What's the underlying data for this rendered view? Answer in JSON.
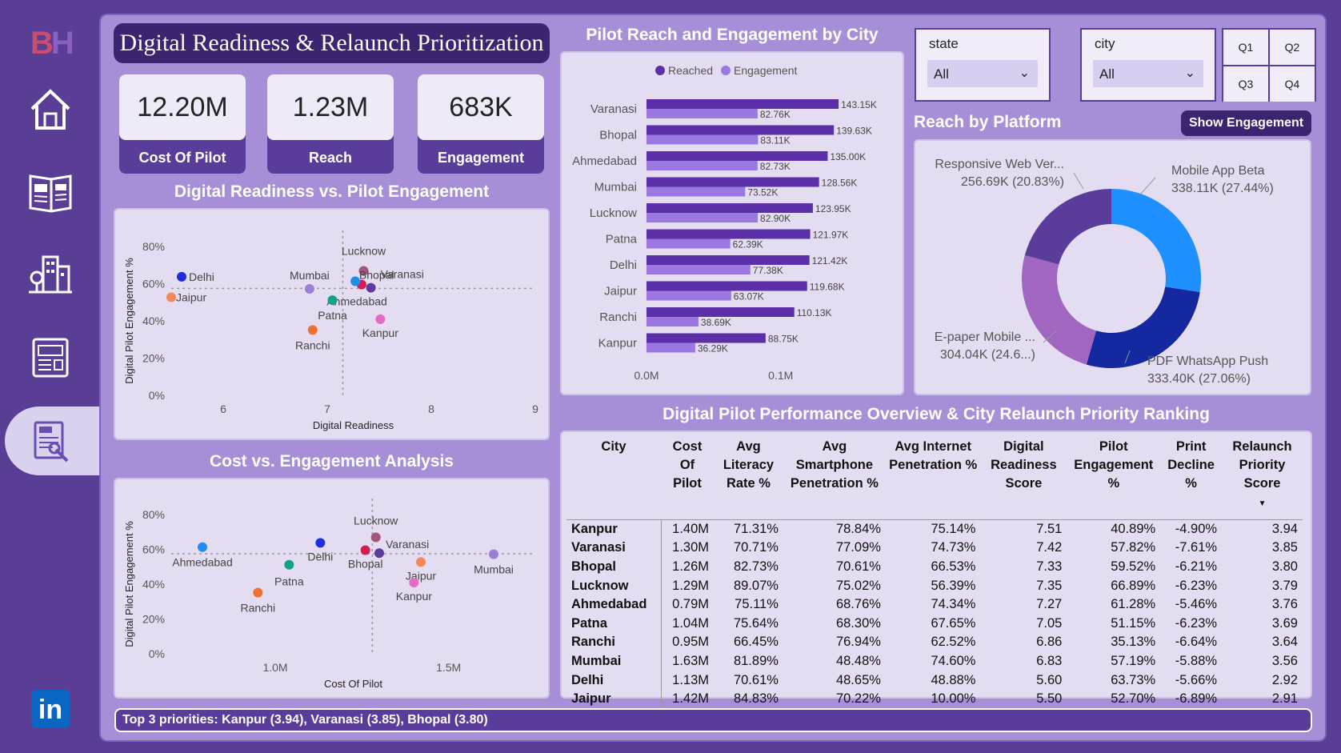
{
  "sidebar": {
    "logo_b": "B",
    "logo_h": "H",
    "items": [
      {
        "name": "home-icon"
      },
      {
        "name": "newspaper-icon"
      },
      {
        "name": "city-buildings-icon"
      },
      {
        "name": "news-report-icon"
      },
      {
        "name": "news-reader-icon",
        "active": true
      }
    ],
    "linkedin_label": "in"
  },
  "header": {
    "title": "Digital Readiness & Relaunch Prioritization"
  },
  "kpis": [
    {
      "value": "12.20M",
      "label": "Cost Of Pilot"
    },
    {
      "value": "1.23M",
      "label": "Reach"
    },
    {
      "value": "683K",
      "label": "Engagement"
    }
  ],
  "filters": {
    "state_label": "state",
    "state_value": "All",
    "city_label": "city",
    "city_value": "All",
    "quarters": [
      "Q1",
      "Q2",
      "Q3",
      "Q4"
    ]
  },
  "show_engagement_label": "Show Engagement",
  "colors": {
    "reached": "#5a2fa8",
    "engagement": "#9b77e0",
    "accent": "#3c2471"
  },
  "chart_data": [
    {
      "id": "readiness_scatter",
      "type": "scatter",
      "title": "Digital Readiness vs. Pilot Engagement",
      "xlabel": "Digital Readiness",
      "ylabel": "Digital Pilot Engagement %",
      "xlim": [
        5.5,
        9
      ],
      "ylim": [
        0,
        80
      ],
      "xticks": [
        "6",
        "7",
        "8",
        "9"
      ],
      "yticks": [
        "0%",
        "20%",
        "40%",
        "60%",
        "80%"
      ],
      "ref_x": 7.15,
      "ref_y": 57.5,
      "points": [
        {
          "label": "Delhi",
          "x": 5.6,
          "y": 63.73,
          "color": "#1f2de0"
        },
        {
          "label": "Jaipur",
          "x": 5.5,
          "y": 52.7,
          "color": "#f08a5a"
        },
        {
          "label": "Mumbai",
          "x": 6.83,
          "y": 57.19,
          "color": "#9b7ed8"
        },
        {
          "label": "Lucknow",
          "x": 7.35,
          "y": 66.89,
          "color": "#a0587a"
        },
        {
          "label": "Bhopal",
          "x": 7.33,
          "y": 59.52,
          "color": "#d11c54"
        },
        {
          "label": "Varanasi",
          "x": 7.42,
          "y": 57.82,
          "color": "#5a3c9a"
        },
        {
          "label": "Ahmedabad",
          "x": 7.27,
          "y": 61.28,
          "color": "#1f8cf0"
        },
        {
          "label": "Patna",
          "x": 7.05,
          "y": 51.15,
          "color": "#17a089"
        },
        {
          "label": "Kanpur",
          "x": 7.51,
          "y": 40.89,
          "color": "#e36bc1"
        },
        {
          "label": "Ranchi",
          "x": 6.86,
          "y": 35.13,
          "color": "#f2702d"
        }
      ]
    },
    {
      "id": "cost_scatter",
      "type": "scatter",
      "title": "Cost vs. Engagement Analysis",
      "xlabel": "Cost Of Pilot",
      "ylabel": "Digital Pilot Engagement %",
      "xlim": [
        0.7,
        1.75
      ],
      "ylim": [
        0,
        80
      ],
      "xticks": [
        "1.0M",
        "1.5M"
      ],
      "yticks": [
        "0%",
        "20%",
        "40%",
        "60%",
        "80%"
      ],
      "ref_x": 1.28,
      "ref_y": 57.5,
      "points": [
        {
          "label": "Ahmedabad",
          "x": 0.79,
          "y": 61.28,
          "color": "#1f8cf0"
        },
        {
          "label": "Delhi",
          "x": 1.13,
          "y": 63.73,
          "color": "#1f2de0"
        },
        {
          "label": "Patna",
          "x": 1.04,
          "y": 51.15,
          "color": "#17a089"
        },
        {
          "label": "Ranchi",
          "x": 0.95,
          "y": 35.13,
          "color": "#f2702d"
        },
        {
          "label": "Lucknow",
          "x": 1.29,
          "y": 66.89,
          "color": "#a0587a"
        },
        {
          "label": "Bhopal",
          "x": 1.26,
          "y": 59.52,
          "color": "#d11c54"
        },
        {
          "label": "Varanasi",
          "x": 1.3,
          "y": 57.82,
          "color": "#5a3c9a"
        },
        {
          "label": "Jaipur",
          "x": 1.42,
          "y": 52.7,
          "color": "#f08a5a"
        },
        {
          "label": "Kanpur",
          "x": 1.4,
          "y": 40.89,
          "color": "#e36bc1"
        },
        {
          "label": "Mumbai",
          "x": 1.63,
          "y": 57.19,
          "color": "#9b7ed8"
        }
      ]
    },
    {
      "id": "reach_bar",
      "type": "bar",
      "orientation": "horizontal",
      "title": "Pilot Reach and Engagement by City",
      "legend": [
        "Reached",
        "Engagement"
      ],
      "xticks": [
        "0.0M",
        "0.1M"
      ],
      "xlim": [
        0,
        0.155
      ],
      "categories": [
        "Varanasi",
        "Bhopal",
        "Ahmedabad",
        "Mumbai",
        "Lucknow",
        "Patna",
        "Delhi",
        "Jaipur",
        "Ranchi",
        "Kanpur"
      ],
      "series": [
        {
          "name": "Reached",
          "values": [
            143.15,
            139.63,
            135.0,
            128.56,
            123.95,
            121.97,
            121.42,
            119.68,
            110.13,
            88.75
          ],
          "labels": [
            "143.15K",
            "139.63K",
            "135.00K",
            "128.56K",
            "123.95K",
            "121.97K",
            "121.42K",
            "119.68K",
            "110.13K",
            "88.75K"
          ]
        },
        {
          "name": "Engagement",
          "values": [
            82.76,
            83.11,
            82.73,
            73.52,
            82.9,
            62.39,
            77.38,
            63.07,
            38.69,
            36.29
          ],
          "labels": [
            "82.76K",
            "83.11K",
            "82.73K",
            "73.52K",
            "82.90K",
            "62.39K",
            "77.38K",
            "63.07K",
            "38.69K",
            "36.29K"
          ]
        }
      ]
    },
    {
      "id": "platform_donut",
      "type": "pie",
      "title": "Reach by Platform",
      "slices": [
        {
          "label": "Mobile App Beta",
          "value": 338.11,
          "pct": 27.44,
          "text": "338.11K (27.44%)",
          "color": "#1e90ff"
        },
        {
          "label": "PDF WhatsApp Push",
          "value": 333.4,
          "pct": 27.06,
          "text": "333.40K (27.06%)",
          "color": "#1428a0"
        },
        {
          "label": "E-paper Mobile ...",
          "value": 304.04,
          "pct": 24.67,
          "text": "304.04K (24.6...)",
          "color": "#a066c0"
        },
        {
          "label": "Responsive Web Ver...",
          "value": 256.69,
          "pct": 20.83,
          "text": "256.69K (20.83%)",
          "color": "#5a3c9a"
        }
      ]
    }
  ],
  "table": {
    "title": "Digital Pilot Performance Overview & City Relaunch Priority Ranking",
    "headers": [
      "City",
      "Cost Of Pilot",
      "Avg Literacy Rate %",
      "Avg Smartphone Penetration %",
      "Avg Internet Penetration %",
      "Digital Readiness Score",
      "Pilot Engagement %",
      "Print Decline %",
      "Relaunch Priority Score"
    ],
    "rows": [
      [
        "Kanpur",
        "1.40M",
        "71.31%",
        "78.84%",
        "75.14%",
        "7.51",
        "40.89%",
        "-4.90%",
        "3.94"
      ],
      [
        "Varanasi",
        "1.30M",
        "70.71%",
        "77.09%",
        "74.73%",
        "7.42",
        "57.82%",
        "-7.61%",
        "3.85"
      ],
      [
        "Bhopal",
        "1.26M",
        "82.73%",
        "70.61%",
        "66.53%",
        "7.33",
        "59.52%",
        "-6.21%",
        "3.80"
      ],
      [
        "Lucknow",
        "1.29M",
        "89.07%",
        "75.02%",
        "56.39%",
        "7.35",
        "66.89%",
        "-6.23%",
        "3.79"
      ],
      [
        "Ahmedabad",
        "0.79M",
        "75.11%",
        "68.76%",
        "74.34%",
        "7.27",
        "61.28%",
        "-5.46%",
        "3.76"
      ],
      [
        "Patna",
        "1.04M",
        "75.64%",
        "68.30%",
        "67.65%",
        "7.05",
        "51.15%",
        "-6.23%",
        "3.69"
      ],
      [
        "Ranchi",
        "0.95M",
        "66.45%",
        "76.94%",
        "62.52%",
        "6.86",
        "35.13%",
        "-6.64%",
        "3.64"
      ],
      [
        "Mumbai",
        "1.63M",
        "81.89%",
        "48.48%",
        "74.60%",
        "6.83",
        "57.19%",
        "-5.88%",
        "3.56"
      ],
      [
        "Delhi",
        "1.13M",
        "70.61%",
        "48.65%",
        "48.88%",
        "5.60",
        "63.73%",
        "-5.66%",
        "2.92"
      ],
      [
        "Jaipur",
        "1.42M",
        "84.83%",
        "70.22%",
        "10.00%",
        "5.50",
        "52.70%",
        "-6.89%",
        "2.91"
      ]
    ]
  },
  "footer": {
    "text": "Top 3 priorities: Kanpur (3.94), Varanasi (3.85), Bhopal (3.80)"
  }
}
